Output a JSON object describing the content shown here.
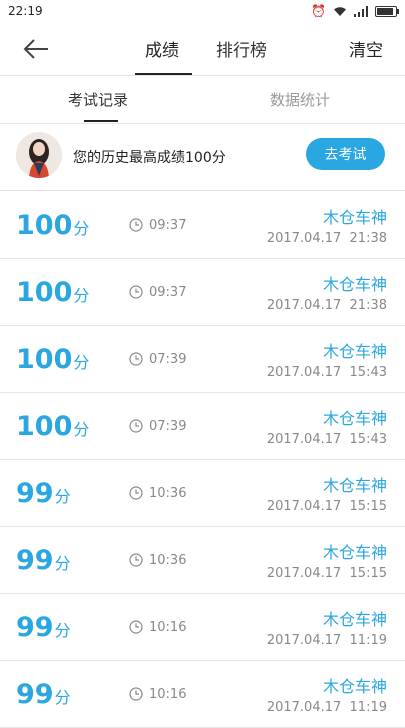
{
  "status_bar": {
    "time": "22:19"
  },
  "header": {
    "tabs": [
      {
        "label": "成绩",
        "active": true
      },
      {
        "label": "排行榜",
        "active": false
      }
    ],
    "clear_label": "清空"
  },
  "sub_tabs": [
    {
      "label": "考试记录",
      "active": true
    },
    {
      "label": "数据统计",
      "active": false
    }
  ],
  "profile": {
    "best_text": "您的历史最高成绩100分",
    "exam_button": "去考试"
  },
  "records": [
    {
      "score": "100",
      "unit": "分",
      "duration": "09:37",
      "name": "木仓车神",
      "date": "2017.04.17  21:38"
    },
    {
      "score": "100",
      "unit": "分",
      "duration": "09:37",
      "name": "木仓车神",
      "date": "2017.04.17  21:38"
    },
    {
      "score": "100",
      "unit": "分",
      "duration": "07:39",
      "name": "木仓车神",
      "date": "2017.04.17  15:43"
    },
    {
      "score": "100",
      "unit": "分",
      "duration": "07:39",
      "name": "木仓车神",
      "date": "2017.04.17  15:43"
    },
    {
      "score": "99",
      "unit": "分",
      "duration": "10:36",
      "name": "木仓车神",
      "date": "2017.04.17  15:15"
    },
    {
      "score": "99",
      "unit": "分",
      "duration": "10:36",
      "name": "木仓车神",
      "date": "2017.04.17  15:15"
    },
    {
      "score": "99",
      "unit": "分",
      "duration": "10:16",
      "name": "木仓车神",
      "date": "2017.04.17  11:19"
    },
    {
      "score": "99",
      "unit": "分",
      "duration": "10:16",
      "name": "木仓车神",
      "date": "2017.04.17  11:19"
    }
  ],
  "colors": {
    "accent": "#2aa7e0",
    "muted": "#888888"
  }
}
